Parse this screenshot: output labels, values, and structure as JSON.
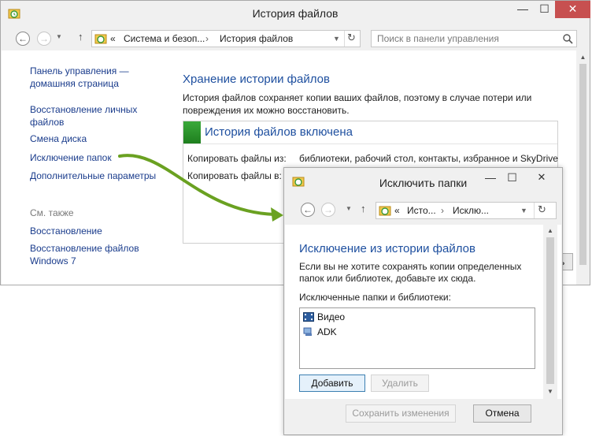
{
  "main_window": {
    "title": "История файлов",
    "controls": {
      "minimize": "—",
      "maximize": "☐",
      "close": "✕"
    },
    "nav": {
      "back": "←",
      "forward": "→",
      "up": "↑"
    },
    "breadcrumb": {
      "prefix": "«",
      "items": [
        "Система и безоп...",
        "История файлов"
      ]
    },
    "refresh": "↻",
    "search": {
      "placeholder": "Поиск в панели управления"
    },
    "sidebar": {
      "links": [
        "Панель управления —\nдомашняя страница",
        "Восстановление личных\nфайлов",
        "Смена диска",
        "Исключение папок",
        "Дополнительные параметры"
      ],
      "see_also_label": "См. также",
      "see_also_links": [
        "Восстановление",
        "Восстановление файлов\nWindows 7"
      ]
    },
    "main": {
      "heading": "Хранение истории файлов",
      "description": "История файлов сохраняет копии ваших файлов, поэтому в случае потери или\nповреждения их можно восстановить.",
      "status_title": "История файлов включена",
      "copy_from_label": "Копировать файлы из:",
      "copy_from_value": "библиотеки, рабочий стол, контакты, избранное и SkyDrive",
      "copy_to_label": "Копировать файлы в:"
    }
  },
  "dialog": {
    "title": "Исключить папки",
    "controls": {
      "minimize": "—",
      "maximize": "☐",
      "close": "✕"
    },
    "breadcrumb": {
      "prefix": "«",
      "items": [
        "Исто...",
        "Исклю..."
      ]
    },
    "heading": "Исключение из истории файлов",
    "description": "Если вы не хотите сохранять копии определенных\nпапок или библиотек, добавьте их сюда.",
    "list_label": "Исключенные папки и библиотеки:",
    "list_items": [
      "Видео",
      "ADK"
    ],
    "add_button": "Добавить",
    "remove_button": "Удалить",
    "save_button": "Сохранить изменения",
    "cancel_button": "Отмена"
  },
  "colors": {
    "link": "#1a3c8c",
    "heading": "#1e4f9f",
    "status_green": "#2e9b2e",
    "arrow": "#6aa121",
    "close_red": "#c75050"
  }
}
